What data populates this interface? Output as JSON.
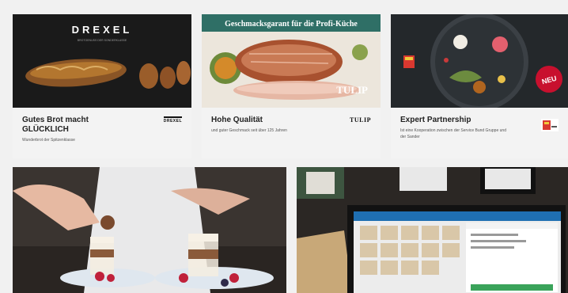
{
  "cards": [
    {
      "title": "Gutes Brot macht GLÜCKLICH",
      "subtitle": "Wunderbrot der Spitzenklasse",
      "image_brand": "DREXEL",
      "image_tagline": "BROTGENUSS DER SONDERKLASSE",
      "logo_text": "DREXEL"
    },
    {
      "title": "Hohe Qualität",
      "subtitle": "und guter Geschmack seit über 125 Jahren",
      "image_headline": "Geschmacksgarant für die Profi-Küche",
      "image_brand": "TULIP",
      "logo_text": "TULIP"
    },
    {
      "title": "Expert Partnership",
      "subtitle": "Ist eine Kooperation zwischen der Service Bund Gruppe und der Sander",
      "badge": "NEU",
      "logo_icon": "partner-logo-icon"
    }
  ],
  "colors": {
    "page_bg": "#f1f1f1",
    "card_body_bg": "#f3f3f3",
    "tulip_banner": "#2f6f66",
    "neu_badge": "#c8102e"
  }
}
